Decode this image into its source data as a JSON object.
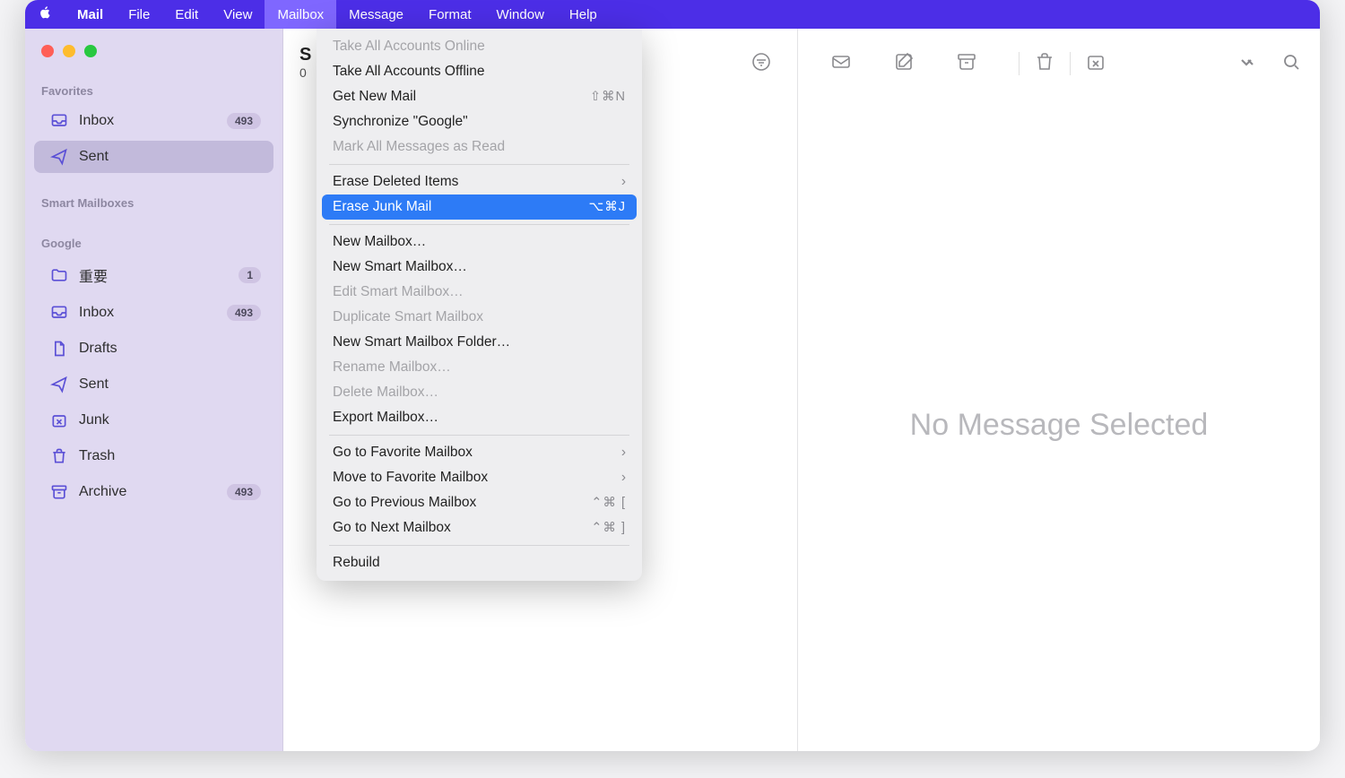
{
  "menubar": {
    "app": "Mail",
    "items": [
      "File",
      "Edit",
      "View",
      "Mailbox",
      "Message",
      "Format",
      "Window",
      "Help"
    ],
    "active": "Mailbox"
  },
  "sidebar": {
    "sections": {
      "favorites": {
        "label": "Favorites",
        "items": [
          {
            "label": "Inbox",
            "badge": "493",
            "icon": "inbox"
          },
          {
            "label": "Sent",
            "badge": "",
            "icon": "sent",
            "selected": true
          }
        ]
      },
      "smart": {
        "label": "Smart Mailboxes"
      },
      "google": {
        "label": "Google",
        "items": [
          {
            "label": "重要",
            "badge": "1",
            "icon": "folder"
          },
          {
            "label": "Inbox",
            "badge": "493",
            "icon": "inbox"
          },
          {
            "label": "Drafts",
            "badge": "",
            "icon": "drafts"
          },
          {
            "label": "Sent",
            "badge": "",
            "icon": "sent"
          },
          {
            "label": "Junk",
            "badge": "",
            "icon": "junk"
          },
          {
            "label": "Trash",
            "badge": "",
            "icon": "trash"
          },
          {
            "label": "Archive",
            "badge": "493",
            "icon": "archive"
          }
        ]
      }
    }
  },
  "middle": {
    "count": "0",
    "header_prefix": "S"
  },
  "right": {
    "empty_text": "No Message Selected"
  },
  "dropdown": {
    "items": [
      {
        "label": "Take All Accounts Online",
        "disabled": true
      },
      {
        "label": "Take All Accounts Offline"
      },
      {
        "label": "Get New Mail",
        "shortcut": "⇧⌘N"
      },
      {
        "label": "Synchronize \"Google\""
      },
      {
        "label": "Mark All Messages as Read",
        "disabled": true
      },
      {
        "sep": true
      },
      {
        "label": "Erase Deleted Items",
        "submenu": true
      },
      {
        "label": "Erase Junk Mail",
        "shortcut": "⌥⌘J",
        "highlighted": true
      },
      {
        "sep": true
      },
      {
        "label": "New Mailbox…"
      },
      {
        "label": "New Smart Mailbox…"
      },
      {
        "label": "Edit Smart Mailbox…",
        "disabled": true
      },
      {
        "label": "Duplicate Smart Mailbox",
        "disabled": true
      },
      {
        "label": "New Smart Mailbox Folder…"
      },
      {
        "label": "Rename Mailbox…",
        "disabled": true
      },
      {
        "label": "Delete Mailbox…",
        "disabled": true
      },
      {
        "label": "Export Mailbox…"
      },
      {
        "sep": true
      },
      {
        "label": "Go to Favorite Mailbox",
        "submenu": true
      },
      {
        "label": "Move to Favorite Mailbox",
        "submenu": true
      },
      {
        "label": "Go to Previous Mailbox",
        "shortcut": "⌃⌘ ["
      },
      {
        "label": "Go to Next Mailbox",
        "shortcut": "⌃⌘ ]"
      },
      {
        "sep": true
      },
      {
        "label": "Rebuild"
      }
    ]
  }
}
